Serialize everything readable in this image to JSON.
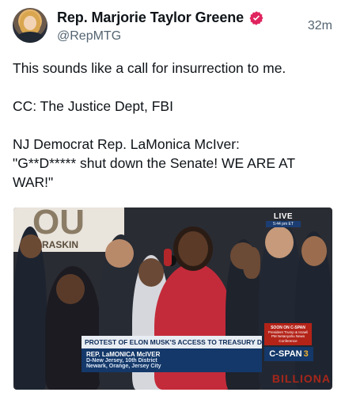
{
  "author": {
    "name": "Rep. Marjorie Taylor Greene",
    "handle": "@RepMTG",
    "verified_badge_color": "#e0245e",
    "time": "32m"
  },
  "tweet": {
    "line1": "This sounds like a call for insurrection to me.",
    "line2": "CC: The Justice Dept, FBI",
    "line3": "NJ Democrat Rep. LaMonica McIver:",
    "line4": "\"G**D***** shut down the Senate! WE ARE AT WAR!\""
  },
  "media": {
    "live_label": "LIVE",
    "live_time": "5:44 pm ET",
    "banner_text": "RASKIN",
    "lower_third": {
      "title": "PROTEST OF ELON MUSK'S ACCESS TO TREASURY DEPT.",
      "name": "REP. LaMONICA McIVER",
      "line1": "D-New Jersey, 10th District",
      "line2": "Newark, Orange, Jersey City"
    },
    "soon_title": "SOON ON C-SPAN",
    "soon_text": "President Trump & Israeli PM Netanyahu News Conference",
    "network": "C-SPAN",
    "network_num": "3",
    "background_sign": "BILLIONA"
  }
}
